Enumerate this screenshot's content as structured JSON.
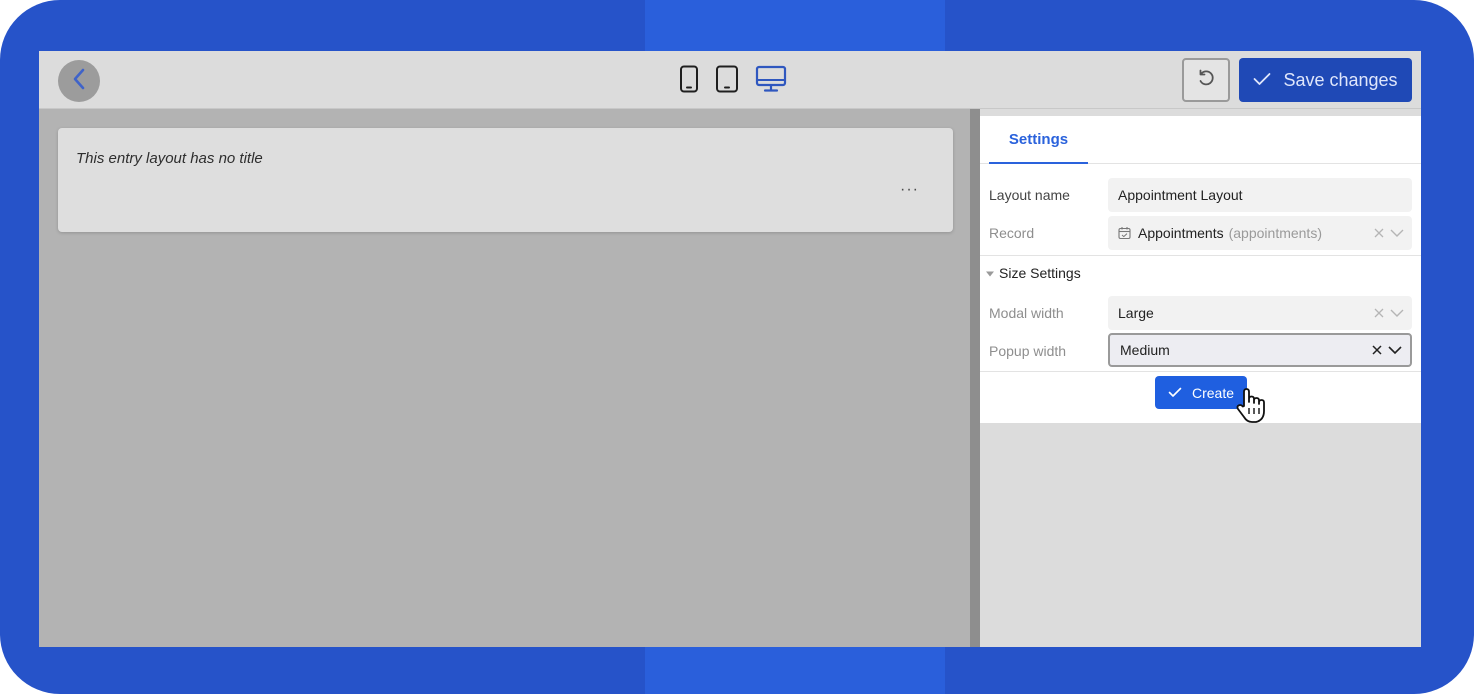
{
  "toolbar": {
    "back_icon": "chevron-left-icon",
    "devices": [
      {
        "name": "mobile",
        "icon": "phone-icon",
        "active": false
      },
      {
        "name": "tablet",
        "icon": "tablet-icon",
        "active": false
      },
      {
        "name": "desktop",
        "icon": "desktop-icon",
        "active": true
      }
    ],
    "undo_icon": "undo-icon",
    "save_label": "Save changes"
  },
  "canvas": {
    "entry_title": "This entry layout has no title",
    "more_label": "···"
  },
  "panel": {
    "tab_label": "Settings",
    "fields": {
      "layout_name": {
        "label": "Layout name",
        "value": "Appointment Layout"
      },
      "record": {
        "label": "Record",
        "value": "Appointments",
        "hint": "(appointments)",
        "icon": "calendar-icon"
      }
    },
    "size_settings": {
      "title": "Size Settings",
      "modal_width": {
        "label": "Modal width",
        "value": "Large"
      },
      "popup_width": {
        "label": "Popup width",
        "value": "Medium"
      }
    },
    "create_label": "Create"
  },
  "colors": {
    "frame": "#2653c9",
    "accent": "#2a62dc",
    "save_button": "#1f49b6",
    "create_button": "#1f5fe0"
  }
}
